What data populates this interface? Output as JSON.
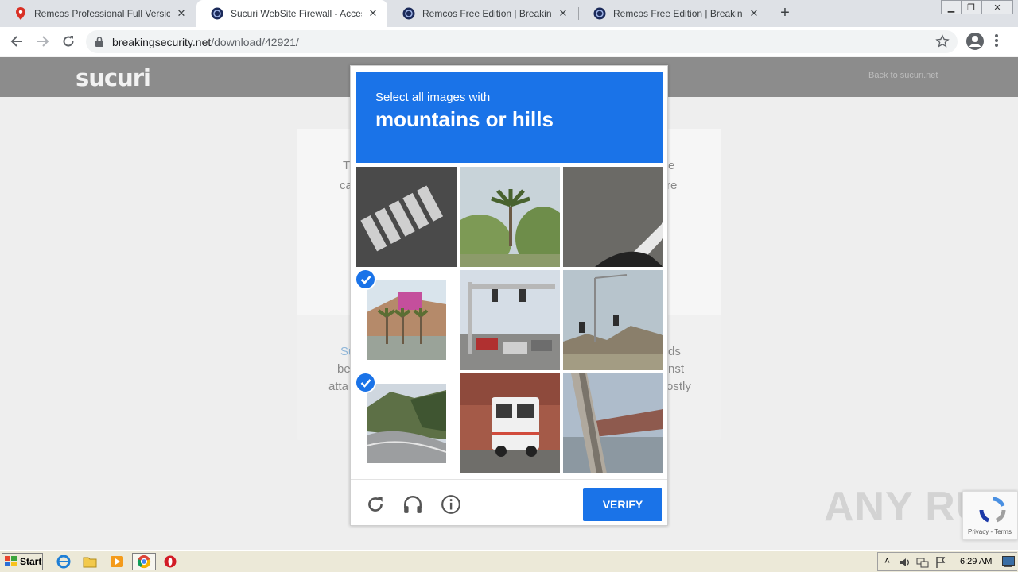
{
  "browser": {
    "tabs": [
      {
        "title": "Remcos Professional Full Version Do",
        "active": false
      },
      {
        "title": "Sucuri WebSite Firewall - Access Den",
        "active": true
      },
      {
        "title": "Remcos Free Edition | BreakingSecur",
        "active": false
      },
      {
        "title": "Remcos Free Edition | BreakingSecur",
        "active": false
      }
    ],
    "url_host": "breakingsecurity.net",
    "url_path": "/download/42921/"
  },
  "page": {
    "logo": "sucuri",
    "back_link": "Back to sucuri.net",
    "fragments": {
      "l1": "T",
      "r1": "e",
      "l2": "ca",
      "r2": "re",
      "l3": "Su",
      "r3": "ds",
      "l4": "be",
      "r4": "nst",
      "l5": "atta",
      "r5": "ostly"
    }
  },
  "captcha": {
    "instruction": "Select all images with",
    "target": "mountains or hills",
    "verify_label": "VERIFY",
    "selected_tiles": [
      3,
      6
    ]
  },
  "badge": {
    "links": "Privacy - Terms"
  },
  "watermark": "ANY RUN",
  "taskbar": {
    "start_label": "Start",
    "clock": "6:29 AM"
  },
  "colors": {
    "captcha_blue": "#1a73e8",
    "sucuri_header": "#8c8c8c"
  }
}
